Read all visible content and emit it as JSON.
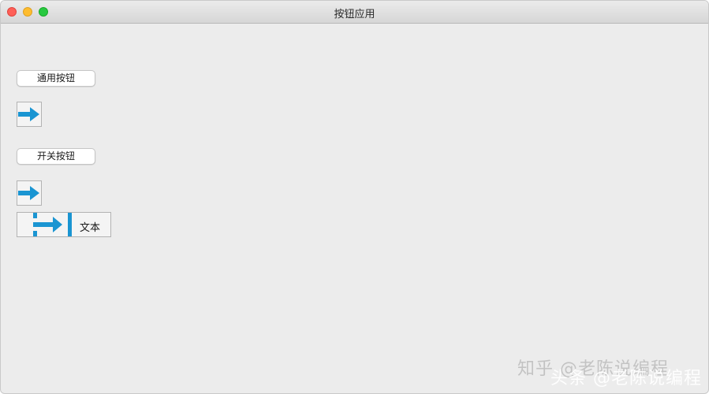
{
  "window": {
    "title": "按钮应用"
  },
  "buttons": {
    "general_label": "通用按钮",
    "toggle_label": "开关按钮",
    "combo_text": "文本"
  },
  "colors": {
    "arrow": "#1a95d2"
  },
  "icons": [
    "arrow-right-icon"
  ],
  "watermarks": [
    "知乎 @老陈说编程",
    "头条 @老陈说编程"
  ]
}
